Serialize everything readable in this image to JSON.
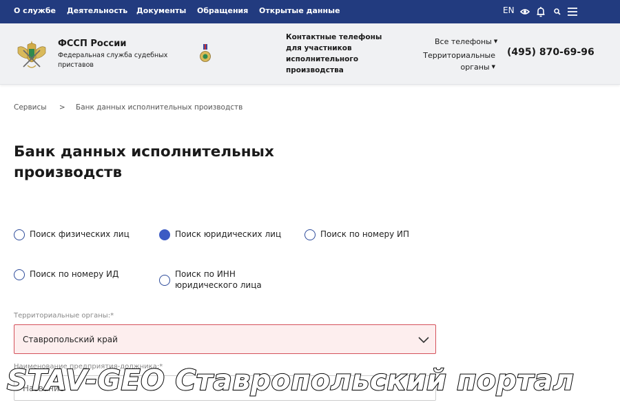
{
  "topnav": {
    "items": [
      "О службе",
      "Деятельность",
      "Документы",
      "Обращения",
      "Открытые данные"
    ],
    "lang": "EN",
    "icons": [
      "eye-icon",
      "bell-icon",
      "search-icon",
      "menu-icon"
    ],
    "bg_color": "#223b7f"
  },
  "header": {
    "org_name": "ФССП России",
    "org_subtitle": "Федеральная служба судебных приставов",
    "contacts_title": "Контактные телефоны для участников исполнительного производства",
    "all_phones": "Все телефоны",
    "territorial_organs": "Территориальные органы",
    "phone": "(495) 870-69-96"
  },
  "breadcrumb": {
    "items": [
      "Сервисы",
      "Банк данных исполнительных производств"
    ],
    "separator": ">"
  },
  "page_title": "Банк данных исполнительных производств",
  "search_modes": [
    {
      "label": "Поиск физических лиц",
      "checked": false
    },
    {
      "label": "Поиск юридических лиц",
      "checked": true
    },
    {
      "label": "Поиск по номеру ИП",
      "checked": false
    },
    {
      "label": "Поиск по номеру ИД",
      "checked": false
    },
    {
      "label": "Поиск по ИНН юридического лица",
      "checked": false
    }
  ],
  "form": {
    "territorial_label": "Территориальные органы:*",
    "territorial_value": "Ставропольский край",
    "name_label": "Наименование предприятия-должника:*",
    "name_placeholder": "Название"
  },
  "watermark": "STAV-GEO Ставропольский портал",
  "colors": {
    "accent": "#3c5bc4",
    "error_border": "#d4505a",
    "error_bg": "#fdeeee"
  }
}
